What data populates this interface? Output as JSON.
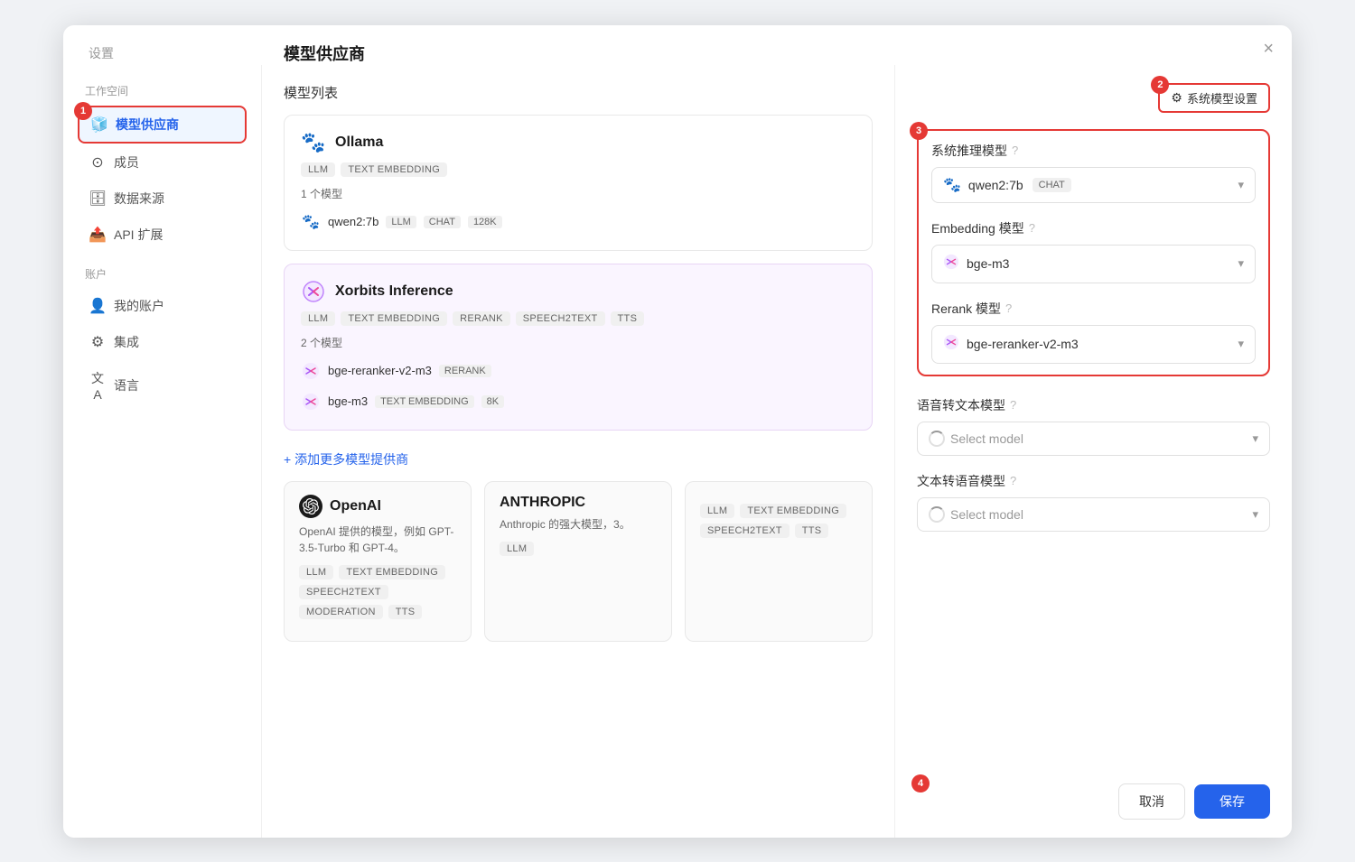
{
  "modal": {
    "title": "模型供应商",
    "close_label": "×"
  },
  "sidebar": {
    "workspace_label": "工作空间",
    "items": [
      {
        "id": "model-provider",
        "label": "模型供应商",
        "icon": "🧊",
        "active": true,
        "badge": "1"
      },
      {
        "id": "members",
        "label": "成员",
        "icon": "👤"
      },
      {
        "id": "datasource",
        "label": "数据来源",
        "icon": "🗄"
      },
      {
        "id": "api-extend",
        "label": "API 扩展",
        "icon": "📤"
      }
    ],
    "account_label": "账户",
    "account_items": [
      {
        "id": "my-account",
        "label": "我的账户",
        "icon": "👤"
      },
      {
        "id": "integration",
        "label": "集成",
        "icon": "🔗"
      },
      {
        "id": "language",
        "label": "语言",
        "icon": "A文"
      }
    ]
  },
  "main": {
    "section_title": "模型列表",
    "providers": [
      {
        "id": "ollama",
        "name": "Ollama",
        "tags": [
          "LLM",
          "TEXT EMBEDDING"
        ],
        "model_count": "1 个模型",
        "models": [
          {
            "name": "qwen2:7b",
            "tags": [
              "LLM",
              "CHAT",
              "128K"
            ],
            "icon": "🦙"
          }
        ]
      },
      {
        "id": "xorbits",
        "name": "Xorbits Inference",
        "tags": [
          "LLM",
          "TEXT EMBEDDING",
          "RERANK",
          "SPEECH2TEXT",
          "TTS"
        ],
        "model_count": "2 个模型",
        "models": [
          {
            "name": "bge-reranker-v2-m3",
            "tags": [
              "RERANK"
            ],
            "icon": "xorbits"
          },
          {
            "name": "bge-m3",
            "tags": [
              "TEXT EMBEDDING",
              "8K"
            ],
            "icon": "xorbits"
          }
        ]
      }
    ],
    "add_more_label": "+ 添加更多模型提供商",
    "suggested": [
      {
        "id": "openai",
        "name": "OpenAI",
        "desc": "OpenAI 提供的模型，例如 GPT-3.5-Turbo 和 GPT-4。",
        "tags": [
          "LLM",
          "TEXT EMBEDDING",
          "SPEECH2TEXT",
          "MODERATION",
          "TTS"
        ]
      },
      {
        "id": "anthropic",
        "name": "ANTHROPIC",
        "desc": "Anthropic 的强大模型，3。",
        "tags": [
          "LLM"
        ]
      },
      {
        "id": "third",
        "name": "",
        "desc": "",
        "tags": [
          "LLM",
          "TEXT EMBEDDING",
          "SPEECH2TEXT",
          "TTS"
        ]
      }
    ]
  },
  "right_panel": {
    "sys_model_btn_label": "系统模型设置",
    "badge2": "2",
    "sections": [
      {
        "id": "inference",
        "label": "系统推理模型",
        "selected_model": "qwen2:7b",
        "selected_tag": "CHAT",
        "has_icon": true,
        "icon_type": "ollama"
      },
      {
        "id": "embedding",
        "label": "Embedding 模型",
        "selected_model": "bge-m3",
        "has_icon": true,
        "icon_type": "xorbits"
      },
      {
        "id": "rerank",
        "label": "Rerank 模型",
        "selected_model": "bge-reranker-v2-m3",
        "has_icon": true,
        "icon_type": "xorbits"
      }
    ],
    "extra_sections": [
      {
        "id": "speech2text",
        "label": "语音转文本模型",
        "placeholder": "Select model"
      },
      {
        "id": "text2speech",
        "label": "文本转语音模型",
        "placeholder": "Select model"
      }
    ],
    "badge3": "3",
    "cancel_label": "取消",
    "save_label": "保存",
    "badge4": "4"
  }
}
